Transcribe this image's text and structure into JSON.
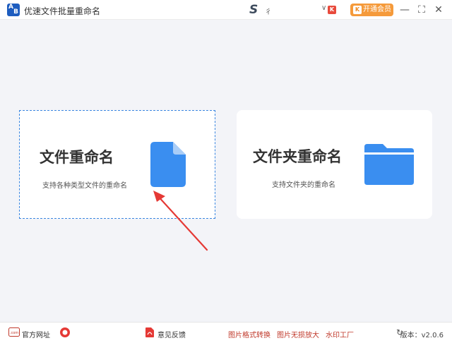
{
  "titlebar": {
    "logo_a": "A",
    "logo_b": "B",
    "title": "优速文件批量重命名",
    "user_name": "彳",
    "chevron": "∨",
    "vip_label": "开通会员",
    "minimize": "—",
    "maximize": "⛶",
    "close": "✕"
  },
  "cards": {
    "file": {
      "title": "文件重命名",
      "subtitle": "支持各种类型文件的重命名"
    },
    "folder": {
      "title": "文件夹重命名",
      "subtitle": "支持文件夹的重命名"
    }
  },
  "footer": {
    "official_site": "官方网址",
    "feedback": "意见反馈",
    "link1": "图片格式转换",
    "link2": "图片无损放大",
    "link3": "水印工厂",
    "version": "版本：v2.0.6"
  },
  "colors": {
    "accent_blue": "#3a8ef0",
    "vip_orange": "#f59a3a",
    "arrow_red": "#e53935"
  }
}
